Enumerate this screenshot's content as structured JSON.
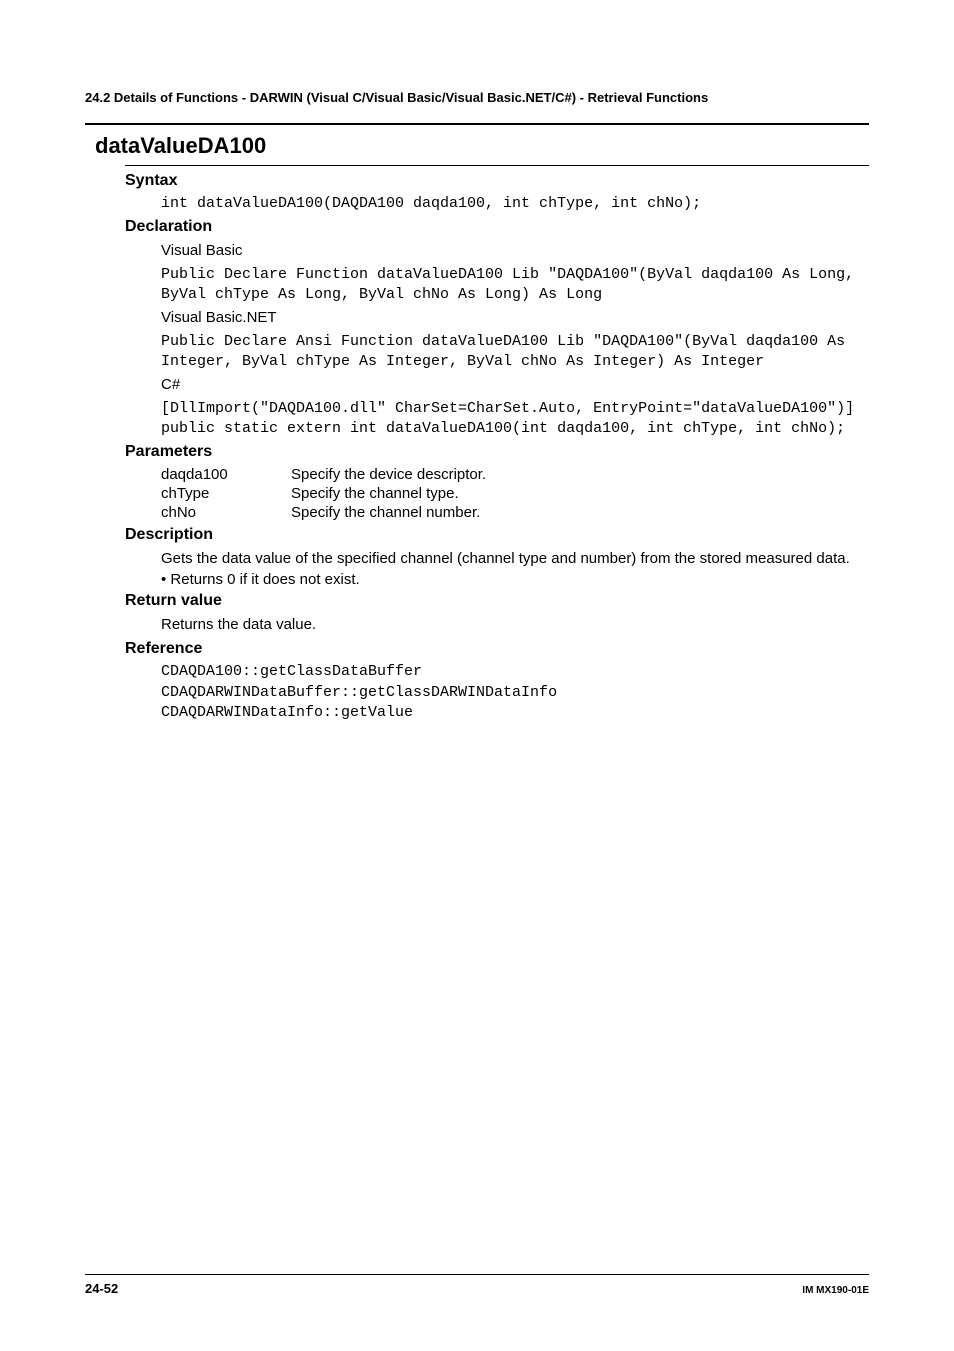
{
  "breadcrumb": "24.2  Details of Functions - DARWIN (Visual C/Visual Basic/Visual Basic.NET/C#) - Retrieval Functions",
  "function_title": "dataValueDA100",
  "syntax": {
    "heading": "Syntax",
    "code": "int dataValueDA100(DAQDA100 daqda100, int chType, int chNo);"
  },
  "declaration": {
    "heading": "Declaration",
    "vb_label": "Visual Basic",
    "vb_code": "Public Declare Function dataValueDA100 Lib \"DAQDA100\"(ByVal daqda100 As Long, ByVal chType As Long, ByVal chNo As Long) As Long",
    "vbnet_label": "Visual Basic.NET",
    "vbnet_code": "Public Declare Ansi Function dataValueDA100 Lib \"DAQDA100\"(ByVal daqda100 As Integer, ByVal chType As Integer, ByVal chNo As Integer) As Integer",
    "cs_label": "C#",
    "cs_code": "[DllImport(\"DAQDA100.dll\" CharSet=CharSet.Auto, EntryPoint=\"dataValueDA100\")]\npublic static extern int dataValueDA100(int daqda100, int chType, int chNo);"
  },
  "parameters": {
    "heading": "Parameters",
    "rows": [
      {
        "name": "daqda100",
        "desc": "Specify the device descriptor."
      },
      {
        "name": "chType",
        "desc": "Specify the channel type."
      },
      {
        "name": "chNo",
        "desc": "Specify the channel number."
      }
    ]
  },
  "description": {
    "heading": "Description",
    "text": "Gets the data value of the specified channel (channel type and number) from the stored measured data.",
    "bullet": "•  Returns 0 if it does not exist."
  },
  "return_value": {
    "heading": "Return value",
    "text": "Returns the data value."
  },
  "reference": {
    "heading": "Reference",
    "code": "CDAQDA100::getClassDataBuffer\nCDAQDARWINDataBuffer::getClassDARWINDataInfo\nCDAQDARWINDataInfo::getValue"
  },
  "footer": {
    "left": "24-52",
    "right": "IM MX190-01E"
  }
}
